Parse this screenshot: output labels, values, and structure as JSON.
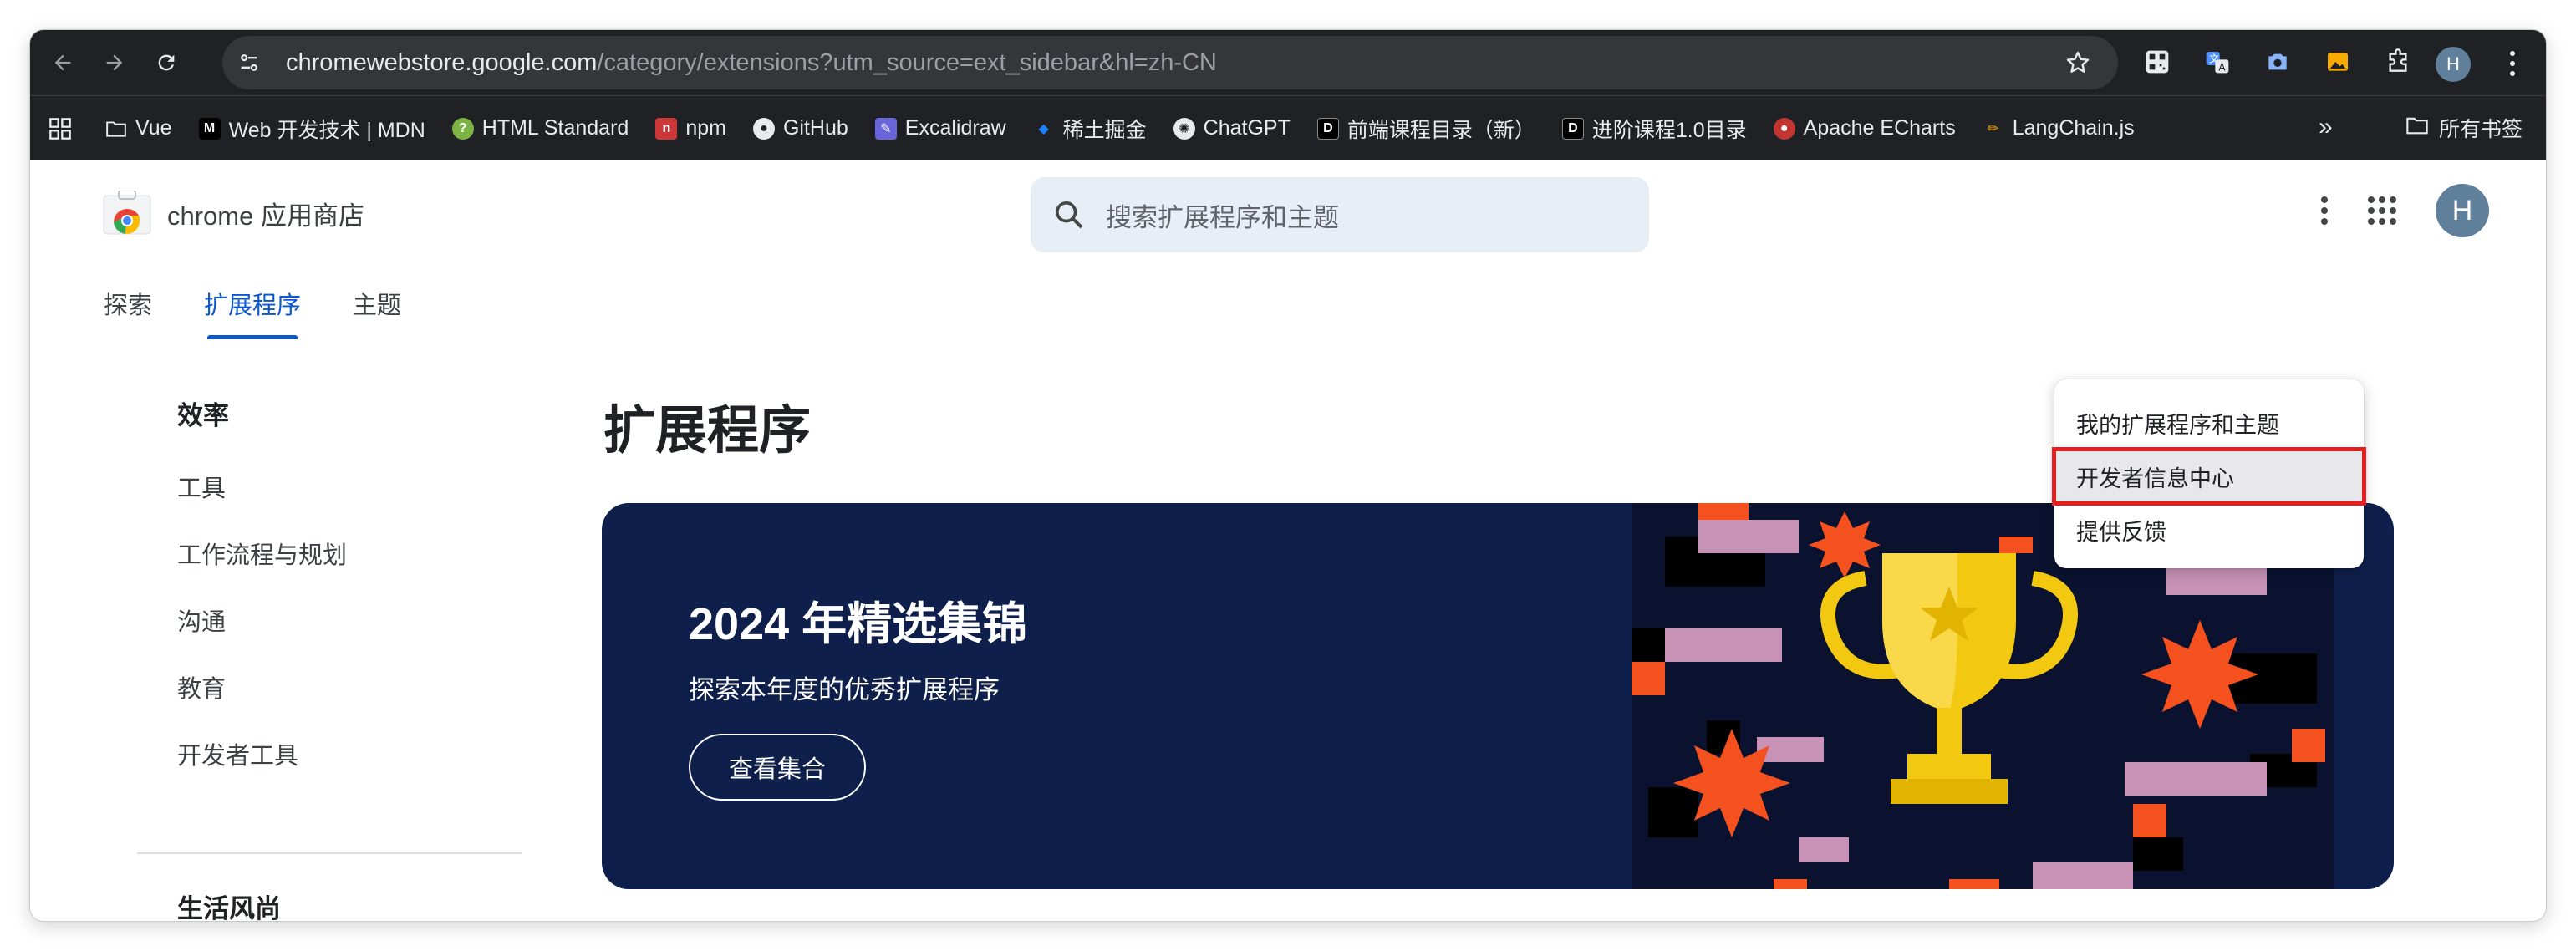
{
  "browser": {
    "url_host": "chromewebstore.google.com",
    "url_path": "/category/extensions?utm_source=ext_sidebar&hl=zh-CN",
    "profile_initial": "H",
    "bookmarks": [
      {
        "label": "Vue",
        "icon": "folder-icon"
      },
      {
        "label": "Web 开发技术 | MDN",
        "icon": "mdn-icon"
      },
      {
        "label": "HTML Standard",
        "icon": "html-standard-icon"
      },
      {
        "label": "npm",
        "icon": "npm-icon"
      },
      {
        "label": "GitHub",
        "icon": "github-icon"
      },
      {
        "label": "Excalidraw",
        "icon": "excalidraw-icon"
      },
      {
        "label": "稀土掘金",
        "icon": "juejin-icon"
      },
      {
        "label": "ChatGPT",
        "icon": "chatgpt-icon"
      },
      {
        "label": "前端课程目录（新）",
        "icon": "notion-icon"
      },
      {
        "label": "进阶课程1.0目录",
        "icon": "notion-icon"
      },
      {
        "label": "Apache ECharts",
        "icon": "echarts-icon"
      },
      {
        "label": "LangChain.js",
        "icon": "langchain-icon"
      }
    ],
    "more_bookmarks": "»",
    "all_bookmarks": "所有书签"
  },
  "store": {
    "logo_text": "chrome 应用商店",
    "search_placeholder": "搜索扩展程序和主题",
    "avatar_initial": "H",
    "tabs": [
      {
        "label": "探索",
        "active": false
      },
      {
        "label": "扩展程序",
        "active": true
      },
      {
        "label": "主题",
        "active": false
      }
    ]
  },
  "sidebar": {
    "heading": "效率",
    "items": [
      "工具",
      "工作流程与规划",
      "沟通",
      "教育",
      "开发者工具"
    ],
    "heading2": "生活风尚"
  },
  "main": {
    "title": "扩展程序",
    "banner": {
      "title": "2024 年精选集锦",
      "subtitle": "探索本年度的优秀扩展程序",
      "button": "查看集合"
    }
  },
  "menu": {
    "items": [
      "我的扩展程序和主题",
      "开发者信息中心",
      "提供反馈"
    ],
    "highlighted_index": 1
  },
  "colors": {
    "accent": "#0b57d0",
    "banner_bg": "#0e1f4b",
    "highlight_border": "#e41e1e",
    "trophy": "#f2c811",
    "starburst": "#f4511e"
  }
}
